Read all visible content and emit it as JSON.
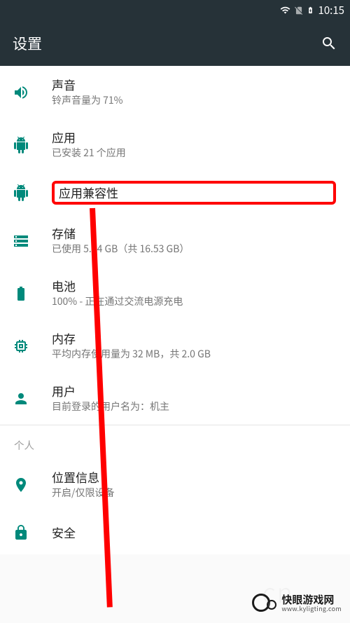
{
  "statusBar": {
    "time": "10:15"
  },
  "appBar": {
    "title": "设置"
  },
  "settings": {
    "sound": {
      "title": "声音",
      "subtitle": "铃声音量为 71%"
    },
    "apps": {
      "title": "应用",
      "subtitle": "已安装 21 个应用"
    },
    "appCompat": {
      "title": "应用兼容性"
    },
    "storage": {
      "title": "存储",
      "subtitle": "已使用 5.04 GB（共 16.53 GB）"
    },
    "battery": {
      "title": "电池",
      "subtitle": "100% - 正在通过交流电源充电"
    },
    "memory": {
      "title": "内存",
      "subtitle": "平均内存使用量为 32 MB，共 2.0 GB"
    },
    "users": {
      "title": "用户",
      "subtitle": "目前登录的用户名为：机主"
    },
    "location": {
      "title": "位置信息",
      "subtitle": "开启/仅限设备"
    },
    "security": {
      "title": "安全"
    }
  },
  "categories": {
    "personal": "个人"
  },
  "watermark": {
    "title": "快眼游戏网",
    "url": "www.kyligting.com",
    "bg": "cn"
  },
  "colors": {
    "accent": "#00897b",
    "highlight": "#ff0000",
    "appBarBg": "#263238"
  }
}
